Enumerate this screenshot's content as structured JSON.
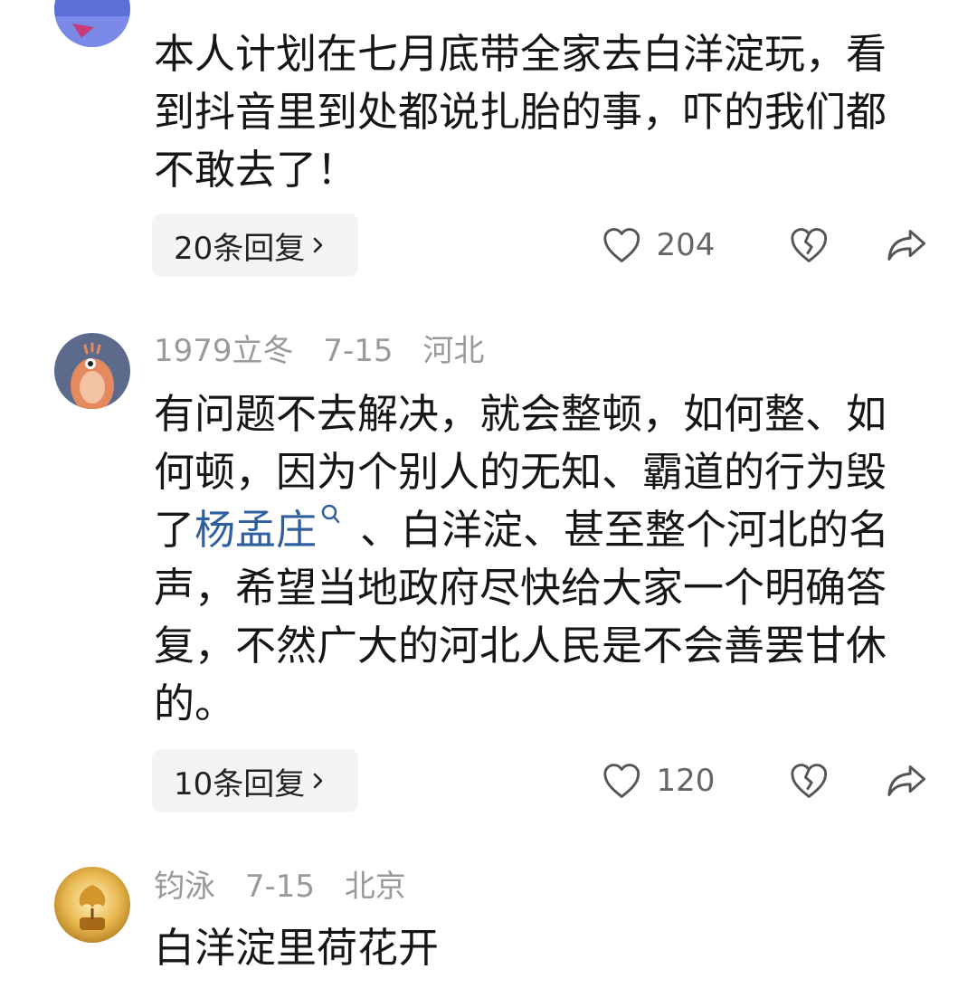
{
  "comments": [
    {
      "text": "本人计划在七月底带全家去白洋淀玩，看到抖音里到处都说扎胎的事，吓的我们都不敢去了！",
      "replies_label": "20条回复",
      "likes": "204",
      "avatar_color": "#5b6fd6"
    },
    {
      "username": "1979立冬",
      "date": "7-15",
      "location": "河北",
      "text_before": "有问题不去解决，就会整顿，如何整、如何顿，因为个别人的无知、霸道的行为毁了",
      "link_text": "杨孟庄",
      "text_after": "、白洋淀、甚至整个河北的名声，希望当地政府尽快给大家一个明确答复，不然广大的河北人民是不会善罢甘休的。",
      "replies_label": "10条回复",
      "likes": "120",
      "avatar_color": "#5c6b8c"
    },
    {
      "username": "钧泳",
      "date": "7-15",
      "location": "北京",
      "text": "白洋淀里荷花开",
      "avatar_color": "#c89a3a"
    }
  ],
  "colors": {
    "link": "#2f5f9e",
    "meta": "#9a9a9a",
    "reply_bg": "#f4f4f4"
  },
  "icons": [
    "heart-outline-icon",
    "broken-heart-icon",
    "share-arrow-icon",
    "chevron-right-icon",
    "search-mini-icon"
  ]
}
